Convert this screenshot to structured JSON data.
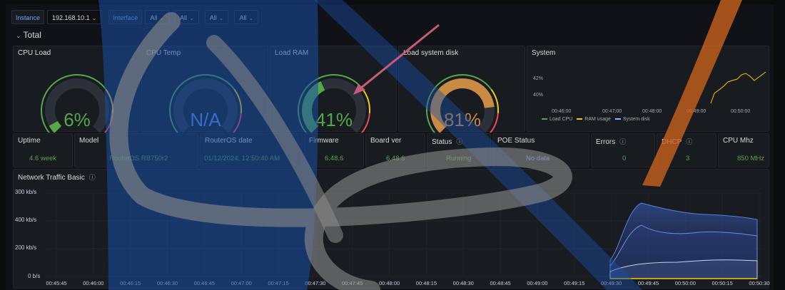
{
  "variables": [
    {
      "label": "Instance",
      "value": "192.168.10.1"
    },
    {
      "label": "Interface",
      "value": "All"
    },
    {
      "label": "",
      "value": "All"
    },
    {
      "label": "",
      "value": "All"
    },
    {
      "label": "",
      "value": "All"
    }
  ],
  "row_title": "Total",
  "gauges": [
    {
      "title": "CPU Load",
      "value": "6%",
      "percent": 6,
      "color": "#56a64b"
    },
    {
      "title": "CPU Temp",
      "value": "N/A",
      "percent": 0,
      "color": "#5794f2"
    },
    {
      "title": "Load RAM",
      "value": "41%",
      "percent": 41,
      "color": "#56a64b"
    },
    {
      "title": "Load system disk",
      "value": "81%",
      "percent": 81,
      "color": "#c98a43"
    }
  ],
  "system": {
    "title": "System",
    "y_ticks": [
      "42%",
      "40%"
    ],
    "x_ticks": [
      "00:46:00",
      "00:47:00",
      "00:48:00",
      "00:49:00",
      "00:50:00"
    ],
    "legend": [
      {
        "name": "Load CPU",
        "color": "#56a64b"
      },
      {
        "name": "RAM usage",
        "color": "#f2cc0c"
      },
      {
        "name": "System disk",
        "color": "#8ab8ff"
      }
    ]
  },
  "stats": [
    {
      "title": "Uptime",
      "value": "4.6 week",
      "color": "#56a64b",
      "info": false
    },
    {
      "title": "Model",
      "value": "RouterOS RB750r2",
      "color": "#56a64b",
      "info": false
    },
    {
      "title": "RouterOS date",
      "value": "01/12/2024, 12:50:40 AM",
      "color": "#56a64b",
      "info": false
    },
    {
      "title": "Firmware",
      "value": "6.48.6",
      "color": "#56a64b",
      "info": false
    },
    {
      "title": "Board ver",
      "value": "6.48.6",
      "color": "#56a64b",
      "info": false
    },
    {
      "title": "Status",
      "value": "Running",
      "color": "#56a64b",
      "info": true
    },
    {
      "title": "POE Status",
      "value": "No data",
      "color": "#6e9fff",
      "info": false
    },
    {
      "title": "Errors",
      "value": "0",
      "color": "#56a64b",
      "info": true
    },
    {
      "title": "DHCP",
      "value": "3",
      "color": "#56a64b",
      "info": true
    },
    {
      "title": "CPU Mhz",
      "value": "850 MHz",
      "color": "#56a64b",
      "info": false
    }
  ],
  "network": {
    "title": "Network Traffic Basic",
    "y_ticks": [
      "300 kb/s",
      "400 kb/s",
      "200 kb/s",
      "0 b/s"
    ],
    "x_ticks": [
      "00:45:45",
      "00:46:00",
      "00:46:15",
      "00:46:30",
      "00:46:45",
      "00:47:00",
      "00:47:15",
      "00:47:30",
      "00:47:45",
      "00:48:00",
      "00:48:15",
      "00:48:30",
      "00:48:45",
      "00:49:00",
      "00:49:15",
      "00:49:30",
      "00:49:45",
      "00:50:00",
      "00:50:15",
      "00:50:30"
    ]
  }
}
